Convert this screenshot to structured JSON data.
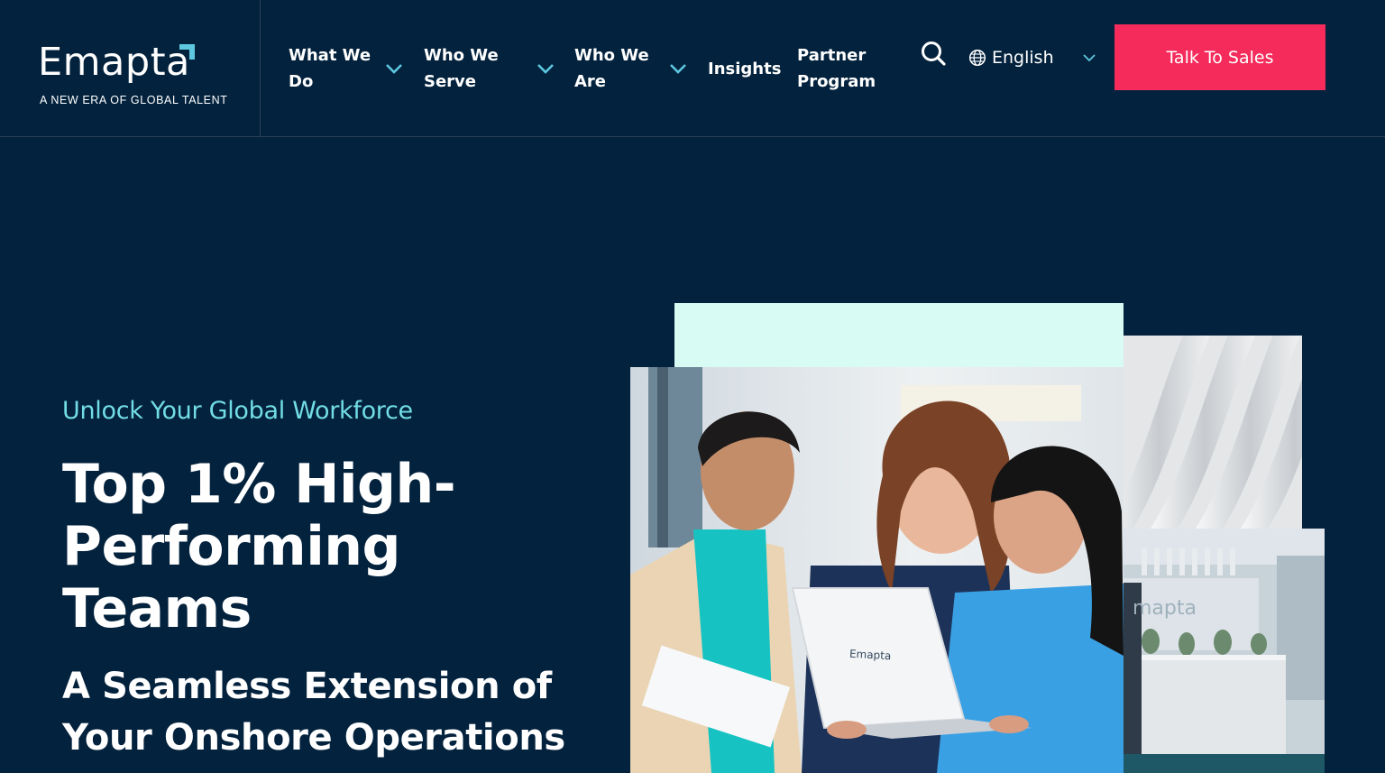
{
  "brand": {
    "name": "Emapta",
    "tagline": "A NEW ERA OF GLOBAL TALENT",
    "laptop_logo": "Emapta",
    "wall_logo": "mapta",
    "accent_color": "#5ec8e0"
  },
  "nav": {
    "items": [
      {
        "label": "What We\nDo",
        "has_dropdown": true
      },
      {
        "label": "Who We\nServe",
        "has_dropdown": true
      },
      {
        "label": "Who We\nAre",
        "has_dropdown": true
      },
      {
        "label": "Insights",
        "has_dropdown": false
      },
      {
        "label": "Partner\nProgram",
        "has_dropdown": false
      }
    ],
    "search_icon": "search-icon",
    "language": {
      "icon": "globe-icon",
      "label": "English"
    },
    "cta_label": "Talk To Sales",
    "cta_color": "#f42b5b"
  },
  "hero": {
    "eyebrow": "Unlock Your Global Workforce",
    "title": "Top 1% High-Performing Teams",
    "subtitle": "A Seamless Extension of Your Onshore Operations",
    "eyebrow_color": "#72dde6",
    "background_color": "#03223d",
    "mint_color": "#d8fbf4"
  }
}
